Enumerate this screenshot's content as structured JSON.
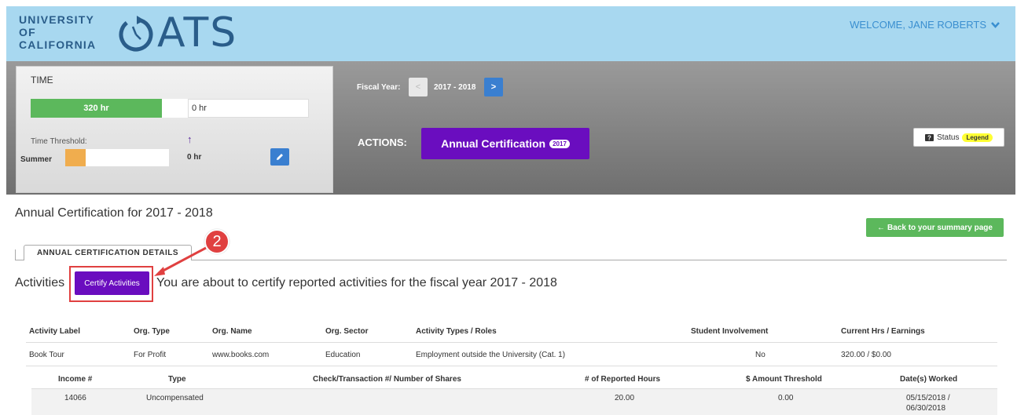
{
  "header": {
    "university_lines": [
      "UNIVERSITY",
      "OF",
      "CALIFORNIA"
    ],
    "app_name": "ATS",
    "welcome": "WELCOME, JANE ROBERTS"
  },
  "time_panel": {
    "title": "TIME",
    "reported_hours": "320 hr",
    "remaining_hours": "0 hr",
    "threshold_label": "Time Threshold:",
    "summer_label": "Summer",
    "summer_hours": "0 hr"
  },
  "fiscal_year": {
    "label": "Fiscal Year:",
    "prev": "<",
    "value": "2017 - 2018",
    "next": ">"
  },
  "actions": {
    "label": "ACTIONS:",
    "annual_button": "Annual Certification",
    "annual_year": "2017"
  },
  "legend": {
    "status": "Status",
    "legend": "Legend"
  },
  "page": {
    "title": "Annual Certification for 2017 - 2018",
    "back_button": "Back to your summary page",
    "tab": "ANNUAL CERTIFICATION DETAILS",
    "activities_label": "Activities",
    "certify_button": "Certify Activities",
    "certify_message": "You are about to certify reported activities for the fiscal year 2017 - 2018",
    "callout_number": "2"
  },
  "activities_table": {
    "headers": [
      "Activity Label",
      "Org. Type",
      "Org. Name",
      "Org. Sector",
      "Activity Types / Roles",
      "Student Involvement",
      "Current Hrs / Earnings"
    ],
    "rows": [
      [
        "Book Tour",
        "For Profit",
        "www.books.com",
        "Education",
        "Employment outside the University (Cat. 1)",
        "No",
        "320.00 / $0.00"
      ]
    ]
  },
  "income_table": {
    "headers": [
      "Income #",
      "Type",
      "Check/Transaction #/ Number of Shares",
      "# of Reported Hours",
      "$ Amount Threshold",
      "Date(s) Worked"
    ],
    "rows": [
      [
        "14066",
        "Uncompensated",
        "",
        "20.00",
        "0.00",
        "05/15/2018 /",
        "06/30/2018"
      ]
    ]
  },
  "colors": {
    "header_bg": "#a8d8f0",
    "brand_blue": "#2a5d8a",
    "purple": "#6a0dbf",
    "green": "#5cb85c",
    "orange": "#f0ad4e",
    "red_annotation": "#e04040"
  }
}
